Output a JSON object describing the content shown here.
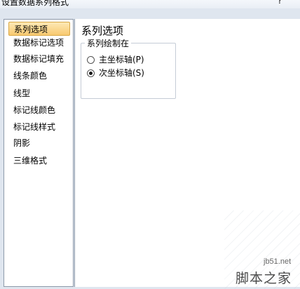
{
  "window": {
    "title": "设置数据系列格式",
    "help_label": "?"
  },
  "nav": {
    "items": [
      {
        "label": "系列选项",
        "selected": true
      },
      {
        "label": "数据标记选项",
        "selected": false
      },
      {
        "label": "数据标记填充",
        "selected": false
      },
      {
        "label": "线条颜色",
        "selected": false
      },
      {
        "label": "线型",
        "selected": false
      },
      {
        "label": "标记线颜色",
        "selected": false
      },
      {
        "label": "标记线样式",
        "selected": false
      },
      {
        "label": "阴影",
        "selected": false
      },
      {
        "label": "三维格式",
        "selected": false
      }
    ]
  },
  "content": {
    "section_title": "系列选项",
    "plot_group": {
      "legend": "系列绘制在",
      "options": [
        {
          "label": "主坐标轴(P)",
          "checked": false
        },
        {
          "label": "次坐标轴(S)",
          "checked": true
        }
      ]
    }
  },
  "watermark": {
    "url": "jb51.net",
    "name": "脚本之家"
  }
}
